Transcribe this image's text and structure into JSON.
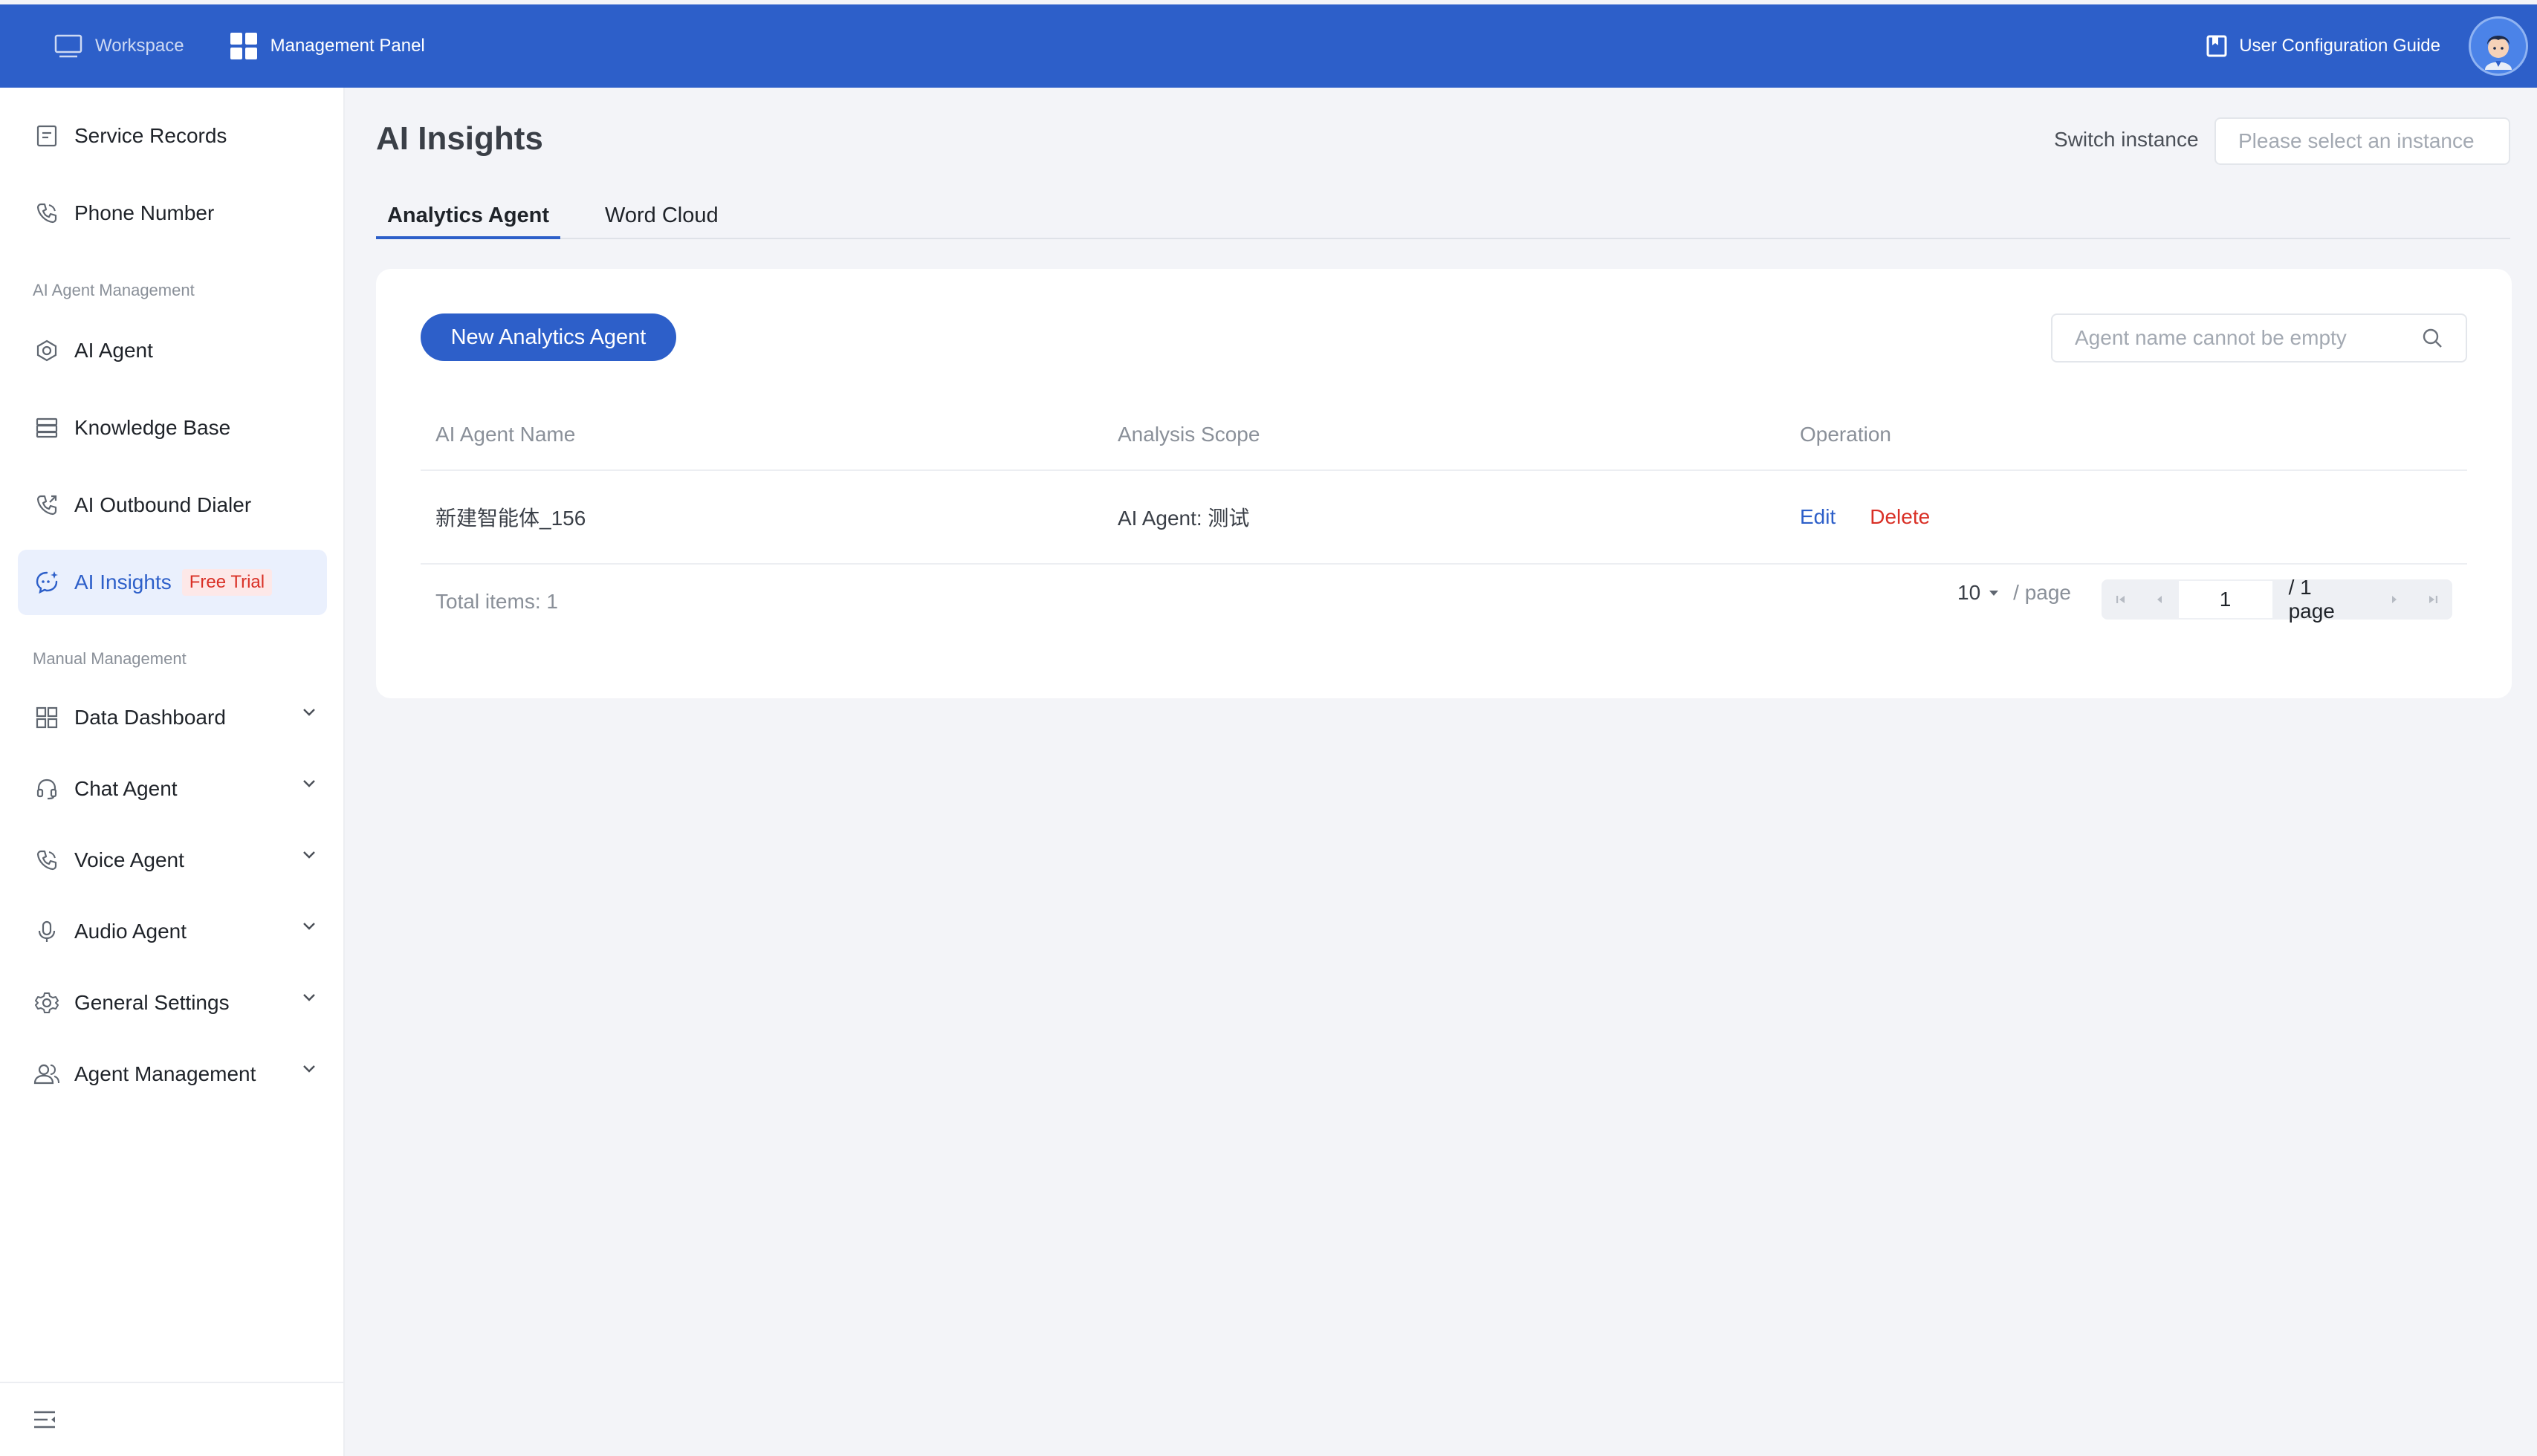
{
  "topbar": {
    "nav": [
      {
        "label": "Workspace",
        "icon": "monitor-icon"
      },
      {
        "label": "Management Panel",
        "icon": "grid-icon"
      }
    ],
    "guide_label": "User Configuration Guide",
    "guide_icon": "book-icon"
  },
  "sidebar": {
    "items_top": [
      {
        "label": "Service Records",
        "icon": "document-icon"
      },
      {
        "label": "Phone Number",
        "icon": "phone-icon"
      }
    ],
    "group_ai": "AI Agent Management",
    "items_ai": [
      {
        "label": "AI Agent",
        "icon": "hexagon-icon"
      },
      {
        "label": "Knowledge Base",
        "icon": "database-icon"
      },
      {
        "label": "AI Outbound Dialer",
        "icon": "phone-outgoing-icon"
      },
      {
        "label": "AI Insights",
        "icon": "chat-sparkle-icon",
        "badge": "Free Trial",
        "active": true
      }
    ],
    "group_manual": "Manual Management",
    "items_manual": [
      {
        "label": "Data Dashboard",
        "icon": "dashboard-icon"
      },
      {
        "label": "Chat Agent",
        "icon": "headset-icon"
      },
      {
        "label": "Voice Agent",
        "icon": "phone-icon"
      },
      {
        "label": "Audio Agent",
        "icon": "microphone-icon"
      },
      {
        "label": "General Settings",
        "icon": "gear-icon"
      },
      {
        "label": "Agent Management",
        "icon": "users-icon"
      }
    ]
  },
  "main": {
    "title": "AI Insights",
    "switch_label": "Switch instance",
    "instance_placeholder": "Please select an instance",
    "tabs": [
      {
        "label": "Analytics Agent",
        "active": true
      },
      {
        "label": "Word Cloud",
        "active": false
      }
    ],
    "new_button": "New Analytics Agent",
    "search_placeholder": "Agent name cannot be empty",
    "table": {
      "columns": [
        "AI Agent Name",
        "Analysis Scope",
        "Operation"
      ],
      "rows": [
        {
          "name": "新建智能体_156",
          "scope": "AI Agent: 测试",
          "actions": [
            "Edit",
            "Delete"
          ]
        }
      ]
    },
    "pagination": {
      "total": "Total items:  1",
      "page_size": "10",
      "per_page": "/ page",
      "current_page": "1",
      "total_pages": "/ 1 page"
    }
  },
  "colors": {
    "brand": "#2d5fc9",
    "danger": "#d93026",
    "active_bg": "#eaf0fd"
  }
}
